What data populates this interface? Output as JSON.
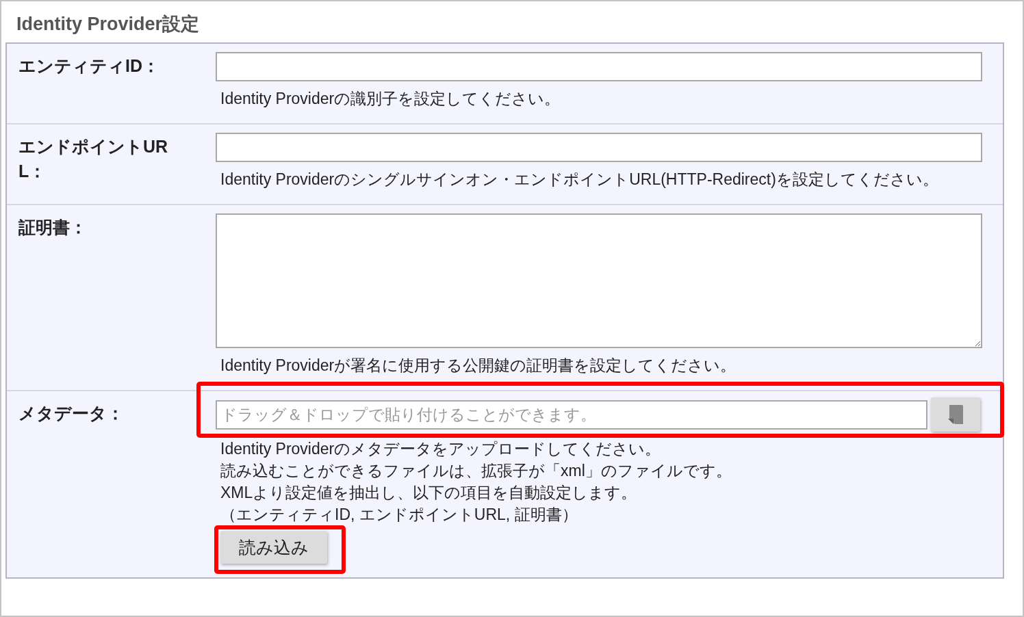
{
  "section_title": "Identity Provider設定",
  "fields": [
    {
      "kind": "text",
      "label": "エンティティID：",
      "help": [
        "Identity Providerの識別子を設定してください。"
      ]
    },
    {
      "kind": "text",
      "label": "エンドポイントURL：",
      "help": [
        "Identity Providerのシングルサインオン・エンドポイントURL(HTTP-Redirect)を設定してください。"
      ]
    },
    {
      "kind": "textarea",
      "label": "証明書：",
      "help": [
        "Identity Providerが署名に使用する公開鍵の証明書を設定してください。"
      ]
    },
    {
      "kind": "file",
      "label": "メタデータ：",
      "placeholder": "ドラッグ＆ドロップで貼り付けることができます。",
      "highlighted": true,
      "help": [
        "Identity Providerのメタデータをアップロードしてください。",
        "読み込むことができるファイルは、拡張子が「xml」のファイルです。",
        "XMLより設定値を抽出し、以下の項目を自動設定します。",
        "（エンティティID, エンドポイントURL, 証明書）"
      ],
      "action": {
        "label": "読み込み",
        "highlighted": true
      }
    }
  ]
}
